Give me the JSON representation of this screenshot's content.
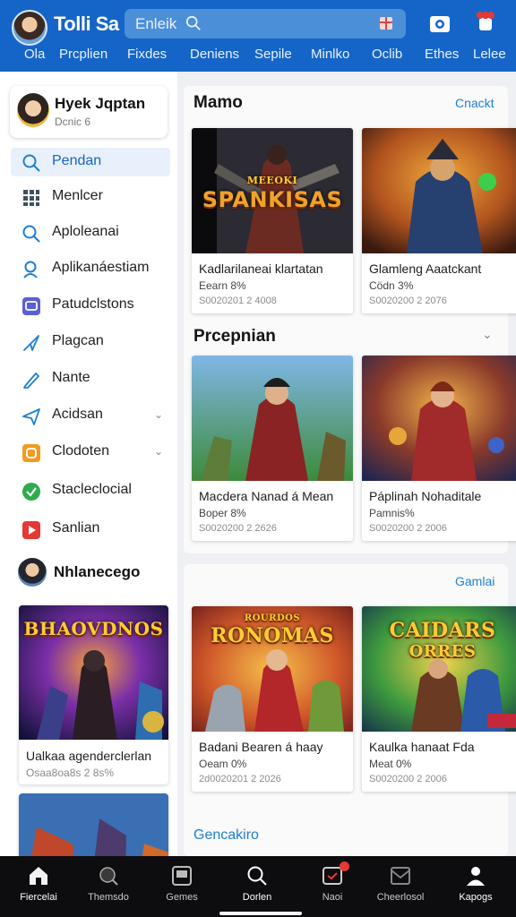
{
  "header": {
    "title": "Tolli Sa",
    "search_placeholder": "Enleik",
    "tabs": [
      "Ola",
      "Prcplien",
      "Fixdes",
      "Deniens",
      "Sepile",
      "Minlko",
      "Oclib",
      "Ethes",
      "Lelee"
    ]
  },
  "sidebar": {
    "profile": {
      "name": "Hyek Jqptan",
      "subtitle": "Dcnic 6"
    },
    "items": [
      {
        "label": "Pendan",
        "icon": "search-icon",
        "active": true
      },
      {
        "label": "Menlcer",
        "icon": "grid-icon"
      },
      {
        "label": "Aploleanai",
        "icon": "search-icon"
      },
      {
        "label": "Aplikanáestiam",
        "icon": "user-icon"
      },
      {
        "label": "Patudclstons",
        "icon": "chat-icon"
      },
      {
        "label": "Plagcan",
        "icon": "send-icon"
      },
      {
        "label": "Nante",
        "icon": "pen-icon"
      },
      {
        "label": "Acidsan",
        "icon": "paper-plane-icon",
        "chevron": true
      },
      {
        "label": "Clodoten",
        "icon": "orange-app-icon",
        "chevron": true
      },
      {
        "label": "Stacleclocial",
        "icon": "shield-icon"
      },
      {
        "label": "Sanlian",
        "icon": "play-icon"
      }
    ],
    "user_section": "Nhlanecego",
    "cards": [
      {
        "title": "Ualkaa agenderclerlan",
        "meta": "Osaa8oa8s 2 8s%",
        "image_text": "BHAOVDNOS"
      },
      {
        "title": "",
        "meta": "",
        "image_text": ""
      }
    ]
  },
  "sections": [
    {
      "title": "Mamo",
      "action": "Cnackt",
      "cards": [
        {
          "title": "Kadlarilaneai klartatan",
          "line2": "Eearn 8%",
          "line3": "S0020201 2 4008",
          "image_text": "SPANKISAS",
          "image_small": "MEEOKI"
        },
        {
          "title": "Glamleng Aaatckant",
          "line2": "Cödn 3%",
          "line3": "S0020200 2 2076",
          "image_text": ""
        }
      ]
    },
    {
      "title": "Prcepnian",
      "action": "",
      "cards": [
        {
          "title": "Macdera Nanad á Mean",
          "line2": "Boper 8%",
          "line3": "S0020200 2 2626",
          "image_text": ""
        },
        {
          "title": "Páplinah Nohaditale",
          "line2": "Pamnis%",
          "line3": "S0020200 2 2006",
          "image_text": ""
        }
      ]
    },
    {
      "title": "",
      "action": "Gamlai",
      "cards": [
        {
          "title": "Badani Bearen á haay",
          "line2": "Oeam 0%",
          "line3": "2d0020201 2 2026",
          "image_text": "RONOMAS",
          "image_small": "ROURDOS"
        },
        {
          "title": "Kaulka hanaat Fda",
          "line2": "Meat 0%",
          "line3": "S0020200 2 2006",
          "image_text": "CAIDARS",
          "image_small": "ORRES"
        }
      ]
    },
    {
      "title": "Gencakiro",
      "action": ""
    }
  ],
  "bottom_nav": [
    {
      "label": "Fiercelai",
      "icon": "home-icon",
      "active": true
    },
    {
      "label": "Themsdo",
      "icon": "search-icon"
    },
    {
      "label": "Gemes",
      "icon": "gamepad-icon"
    },
    {
      "label": "Dorlen",
      "icon": "search-icon",
      "active": true
    },
    {
      "label": "Naoi",
      "icon": "inbox-icon",
      "badge": true
    },
    {
      "label": "Cheerlosol",
      "icon": "mail-icon"
    },
    {
      "label": "Kapogs",
      "icon": "profile-icon",
      "active": true
    }
  ],
  "colors": {
    "header": "#1565c8",
    "accent": "#1e7fd1",
    "bottom_nav": "#0d0d0f"
  }
}
